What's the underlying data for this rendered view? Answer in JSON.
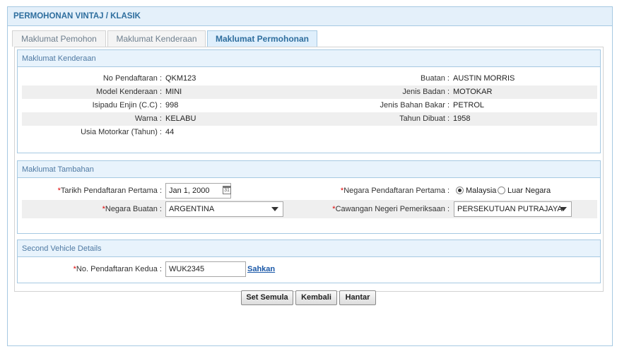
{
  "title": "PERMOHONAN VINTAJ / KLASIK",
  "tabs": [
    {
      "label": "Maklumat Pemohon"
    },
    {
      "label": "Maklumat Kenderaan"
    },
    {
      "label": "Maklumat Permohonan"
    }
  ],
  "vehicle": {
    "heading": "Maklumat Kenderaan",
    "rows": [
      {
        "l_label": "No Pendaftaran :",
        "l_value": "QKM123",
        "r_label": "Buatan :",
        "r_value": "AUSTIN MORRIS"
      },
      {
        "l_label": "Model Kenderaan :",
        "l_value": "MINI",
        "r_label": "Jenis Badan :",
        "r_value": "MOTOKAR"
      },
      {
        "l_label": "Isipadu Enjin (C.C) :",
        "l_value": "998",
        "r_label": "Jenis Bahan Bakar :",
        "r_value": "PETROL"
      },
      {
        "l_label": "Warna :",
        "l_value": "KELABU",
        "r_label": "Tahun Dibuat :",
        "r_value": "1958"
      },
      {
        "l_label": "Usia Motorkar (Tahun) :",
        "l_value": "44",
        "r_label": "",
        "r_value": ""
      }
    ]
  },
  "additional": {
    "heading": "Maklumat Tambahan",
    "req_mark": "*",
    "reg_date_label": "Tarikh Pendaftaran Pertama :",
    "reg_date_value": "Jan 1, 2000",
    "first_reg_country_label": "Negara Pendaftaran Pertama :",
    "radio_malaysia": "Malaysia",
    "radio_luar": "Luar Negara",
    "maker_country_label": "Negara Buatan :",
    "maker_country_value": "ARGENTINA",
    "branch_label": "Cawangan Negeri Pemeriksaan :",
    "branch_value": "PERSEKUTUAN PUTRAJAYA",
    "calendar_icon_text": "31"
  },
  "second": {
    "heading": "Second Vehicle Details",
    "reg_label": "No. Pendaftaran Kedua :",
    "reg_value": "WUK2345",
    "verify_link": "Sahkan"
  },
  "buttons": {
    "reset": "Set Semula",
    "back": "Kembali",
    "submit": "Hantar"
  },
  "colors": {
    "header_bg": "#e4f0fa",
    "header_text": "#2e6e9e",
    "required": "#dd0000",
    "link": "#1a58a8"
  }
}
